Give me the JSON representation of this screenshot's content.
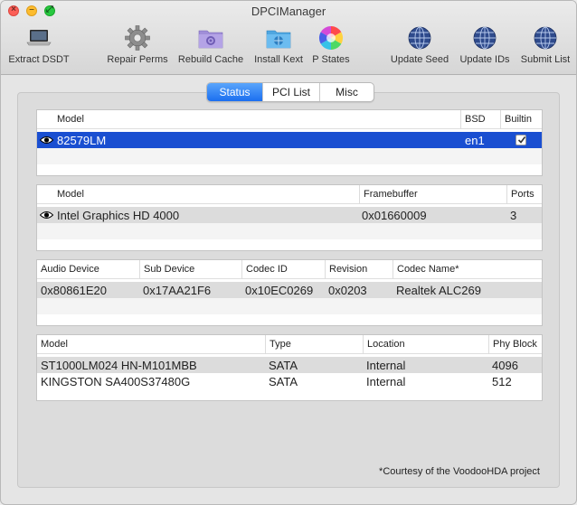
{
  "window": {
    "title": "DPCIManager"
  },
  "toolbar": {
    "items": [
      {
        "label": "Extract DSDT",
        "icon": "laptop-icon"
      },
      {
        "label": "Repair Perms",
        "icon": "gear-icon"
      },
      {
        "label": "Rebuild Cache",
        "icon": "folder-gear-icon"
      },
      {
        "label": "Install Kext",
        "icon": "folder-globe-icon"
      },
      {
        "label": "P States",
        "icon": "color-wheel-icon"
      },
      {
        "label": "Update Seed",
        "icon": "globe-icon"
      },
      {
        "label": "Update IDs",
        "icon": "globe-icon"
      },
      {
        "label": "Submit List",
        "icon": "globe-icon"
      }
    ]
  },
  "tabs": [
    {
      "label": "Status",
      "active": true
    },
    {
      "label": "PCI List",
      "active": false
    },
    {
      "label": "Misc",
      "active": false
    }
  ],
  "network_table": {
    "headers": [
      "Model",
      "BSD",
      "Builtin"
    ],
    "rows": [
      {
        "model": "82579LM",
        "bsd": "en1",
        "builtin": true
      }
    ]
  },
  "graphics_table": {
    "headers": [
      "Model",
      "Framebuffer",
      "Ports"
    ],
    "rows": [
      {
        "model": "Intel Graphics HD 4000",
        "framebuffer": "0x01660009",
        "ports": "3"
      }
    ]
  },
  "audio_table": {
    "headers": [
      "Audio Device",
      "Sub Device",
      "Codec ID",
      "Revision",
      "Codec Name*"
    ],
    "rows": [
      {
        "audio_device": "0x80861E20",
        "sub_device": "0x17AA21F6",
        "codec_id": "0x10EC0269",
        "revision": "0x0203",
        "codec_name": "Realtek ALC269"
      }
    ]
  },
  "storage_table": {
    "headers": [
      "Model",
      "Type",
      "Location",
      "Phy Block"
    ],
    "rows": [
      {
        "model": "ST1000LM024 HN-M101MBB",
        "type": "SATA",
        "location": "Internal",
        "phy_block": "4096"
      },
      {
        "model": "KINGSTON SA400S37480G",
        "type": "SATA",
        "location": "Internal",
        "phy_block": "512"
      }
    ]
  },
  "footnote": "*Courtesy of the VoodooHDA project",
  "colors": {
    "selection": "#1a4fd1",
    "tab_active": "#2a7bf5"
  }
}
